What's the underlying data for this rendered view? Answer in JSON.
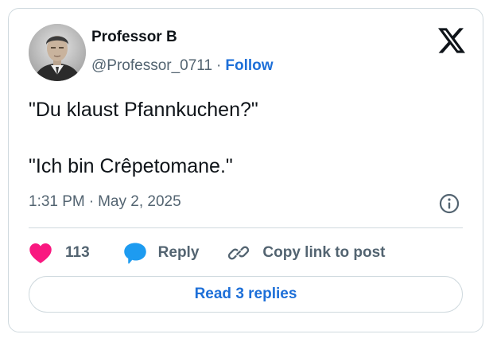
{
  "author": {
    "name": "Professor B",
    "handle": "@Professor_0711",
    "separator": "·",
    "follow_label": "Follow",
    "avatar_icon": "portrait-photo"
  },
  "brand": {
    "logo_icon": "x-logo",
    "logo_color": "#0f1419"
  },
  "tweet": {
    "lines": [
      "\"Du klaust Pfannkuchen?\"",
      "\"Ich bin Crêpetomane.\""
    ],
    "time": "1:31 PM",
    "separator": "·",
    "date": "May 2, 2025",
    "info_icon": "info-circle-icon"
  },
  "actions": {
    "like_icon": "heart-icon",
    "like_color": "#f91880",
    "like_count": "113",
    "reply_icon": "speech-bubble-icon",
    "reply_color": "#1d9bf0",
    "reply_label": "Reply",
    "copy_icon": "link-icon",
    "copy_label": "Copy link to post"
  },
  "footer": {
    "read_replies_label": "Read 3 replies",
    "accent_color": "#1d6fd8"
  }
}
